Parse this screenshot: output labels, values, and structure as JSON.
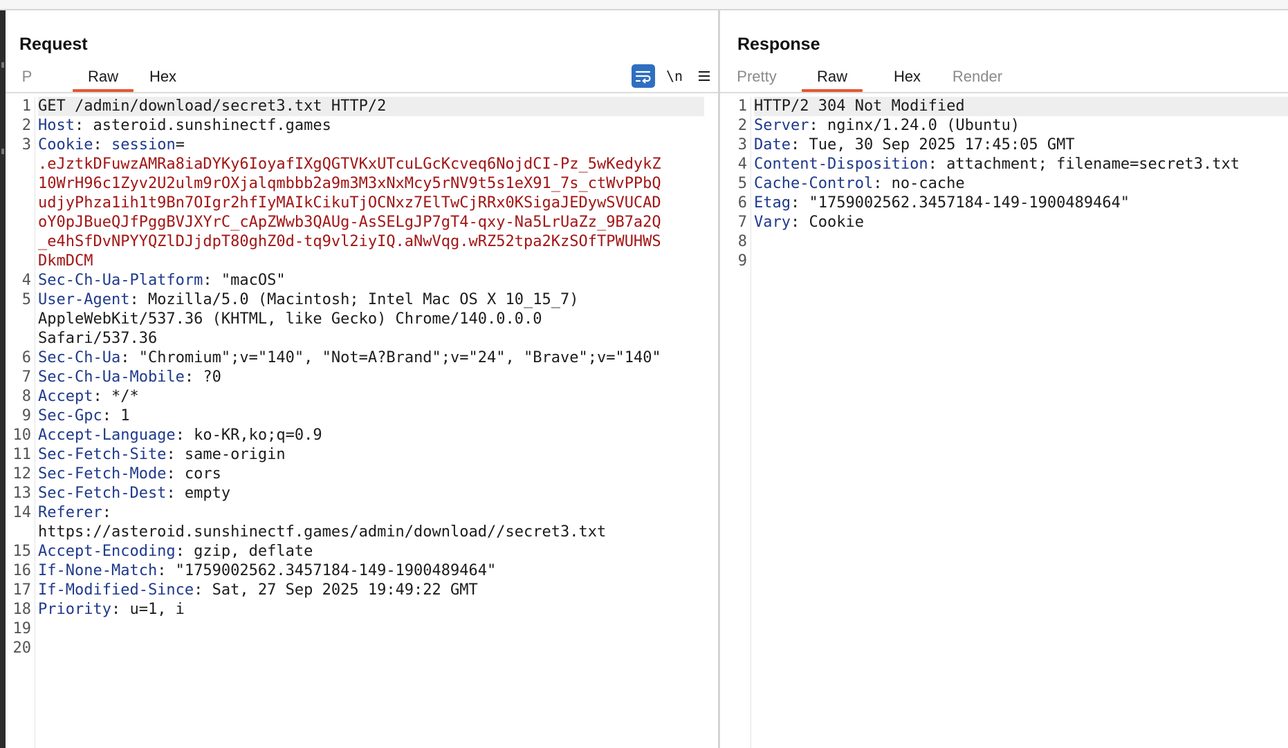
{
  "request": {
    "title": "Request",
    "tabs": [
      {
        "label": "P",
        "state": "dim"
      },
      {
        "label": "Raw",
        "state": "active"
      },
      {
        "label": "Hex",
        "state": "normal"
      }
    ],
    "toolbar": {
      "wrap_icon": "wrap-lines-icon",
      "newline_label": "\\n",
      "menu_icon": "hamburger-menu-icon"
    },
    "lines": [
      [
        {
          "t": "GET /admin/download/secret3.txt HTTP/2",
          "c": "p"
        }
      ],
      [
        {
          "t": "Host",
          "c": "h"
        },
        {
          "t": ": asteroid.sunshinectf.games",
          "c": "p"
        }
      ],
      [
        {
          "t": "Cookie",
          "c": "h"
        },
        {
          "t": ": ",
          "c": "p"
        },
        {
          "t": "session",
          "c": "h"
        },
        {
          "t": "=",
          "c": "p"
        }
      ],
      [
        {
          "t": ".eJztkDFuwzAMRa8iaDYKy6IoyafIXgQGTVKxUTcuLGcKcveq6NojdCI-Pz_5wKedykZ",
          "c": "r"
        }
      ],
      [
        {
          "t": "10WrH96c1Zyv2U2ulm9rOXjalqmbbb2a9m3M3xNxMcy5rNV9t5s1eX91_7s_ctWvPPbQ",
          "c": "r"
        }
      ],
      [
        {
          "t": "udjyPhza1ih1t9Bn7OIgr2hfIyMAIkCikuTjOCNxz7ElTwCjRRx0KSigaJEDywSVUCAD",
          "c": "r"
        }
      ],
      [
        {
          "t": "oY0pJBueQJfPggBVJXYrC_cApZWwb3QAUg-AsSELgJP7gT4-qxy-Na5LrUaZz_9B7a2Q",
          "c": "r"
        }
      ],
      [
        {
          "t": "_e4hSfDvNPYYQZlDJjdpT80ghZ0d-tq9vl2iyIQ.aNwVqg.wRZ52tpa2KzSOfTPWUHWS",
          "c": "r"
        }
      ],
      [
        {
          "t": "DkmDCM",
          "c": "r"
        }
      ],
      [
        {
          "t": "Sec-Ch-Ua-Platform",
          "c": "h"
        },
        {
          "t": ": \"macOS\"",
          "c": "p"
        }
      ],
      [
        {
          "t": "User-Agent",
          "c": "h"
        },
        {
          "t": ": Mozilla/5.0 (Macintosh; Intel Mac OS X 10_15_7)",
          "c": "p"
        }
      ],
      [
        {
          "t": "AppleWebKit/537.36 (KHTML, like Gecko) Chrome/140.0.0.0",
          "c": "p"
        }
      ],
      [
        {
          "t": "Safari/537.36",
          "c": "p"
        }
      ],
      [
        {
          "t": "Sec-Ch-Ua",
          "c": "h"
        },
        {
          "t": ": \"Chromium\";v=\"140\", \"Not=A?Brand\";v=\"24\", \"Brave\";v=\"140\"",
          "c": "p"
        }
      ],
      [
        {
          "t": "Sec-Ch-Ua-Mobile",
          "c": "h"
        },
        {
          "t": ": ?0",
          "c": "p"
        }
      ],
      [
        {
          "t": "Accept",
          "c": "h"
        },
        {
          "t": ": */*",
          "c": "p"
        }
      ],
      [
        {
          "t": "Sec-Gpc",
          "c": "h"
        },
        {
          "t": ": 1",
          "c": "p"
        }
      ],
      [
        {
          "t": "Accept-Language",
          "c": "h"
        },
        {
          "t": ": ko-KR,ko;q=0.9",
          "c": "p"
        }
      ],
      [
        {
          "t": "Sec-Fetch-Site",
          "c": "h"
        },
        {
          "t": ": same-origin",
          "c": "p"
        }
      ],
      [
        {
          "t": "Sec-Fetch-Mode",
          "c": "h"
        },
        {
          "t": ": cors",
          "c": "p"
        }
      ],
      [
        {
          "t": "Sec-Fetch-Dest",
          "c": "h"
        },
        {
          "t": ": empty",
          "c": "p"
        }
      ],
      [
        {
          "t": "Referer",
          "c": "h"
        },
        {
          "t": ":",
          "c": "p"
        }
      ],
      [
        {
          "t": "https://asteroid.sunshinectf.games/admin/download//secret3.txt",
          "c": "p"
        }
      ],
      [
        {
          "t": "Accept-Encoding",
          "c": "h"
        },
        {
          "t": ": gzip, deflate",
          "c": "p"
        }
      ],
      [
        {
          "t": "If-None-Match",
          "c": "h"
        },
        {
          "t": ": \"1759002562.3457184-149-1900489464\"",
          "c": "p"
        }
      ],
      [
        {
          "t": "If-Modified-Since",
          "c": "h"
        },
        {
          "t": ": Sat, 27 Sep 2025 19:49:22 GMT",
          "c": "p"
        }
      ],
      [
        {
          "t": "Priority",
          "c": "h"
        },
        {
          "t": ": u=1, i",
          "c": "p"
        }
      ],
      [],
      []
    ],
    "gutter": [
      "1",
      "2",
      "3",
      "",
      "",
      "",
      "",
      "",
      "",
      "4",
      "5",
      "",
      "",
      "6",
      "7",
      "8",
      "9",
      "10",
      "11",
      "12",
      "13",
      "14",
      "",
      "15",
      "16",
      "17",
      "18",
      "19",
      "20"
    ]
  },
  "response": {
    "title": "Response",
    "tabs": [
      {
        "label": "Pretty",
        "state": "dim"
      },
      {
        "label": "Raw",
        "state": "active"
      },
      {
        "label": "Hex",
        "state": "normal"
      },
      {
        "label": "Render",
        "state": "dim"
      }
    ],
    "lines": [
      [
        {
          "t": "HTTP/2 304 Not Modified",
          "c": "p"
        }
      ],
      [
        {
          "t": "Server",
          "c": "h"
        },
        {
          "t": ": nginx/1.24.0 (Ubuntu)",
          "c": "p"
        }
      ],
      [
        {
          "t": "Date",
          "c": "h"
        },
        {
          "t": ": Tue, 30 Sep 2025 17:45:05 GMT",
          "c": "p"
        }
      ],
      [
        {
          "t": "Content-Disposition",
          "c": "h"
        },
        {
          "t": ": attachment; filename=secret3.txt",
          "c": "p"
        }
      ],
      [
        {
          "t": "Cache-Control",
          "c": "h"
        },
        {
          "t": ": no-cache",
          "c": "p"
        }
      ],
      [
        {
          "t": "Etag",
          "c": "h"
        },
        {
          "t": ": \"1759002562.3457184-149-1900489464\"",
          "c": "p"
        }
      ],
      [
        {
          "t": "Vary",
          "c": "h"
        },
        {
          "t": ": Cookie",
          "c": "p"
        }
      ],
      [],
      []
    ],
    "gutter": [
      "1",
      "2",
      "3",
      "4",
      "5",
      "6",
      "7",
      "8",
      "9"
    ]
  },
  "colors": {
    "accent": "#e4572e",
    "header_name": "#1f3a8c",
    "cookie_value": "#a31515",
    "wrap_button": "#2f6fc0"
  }
}
